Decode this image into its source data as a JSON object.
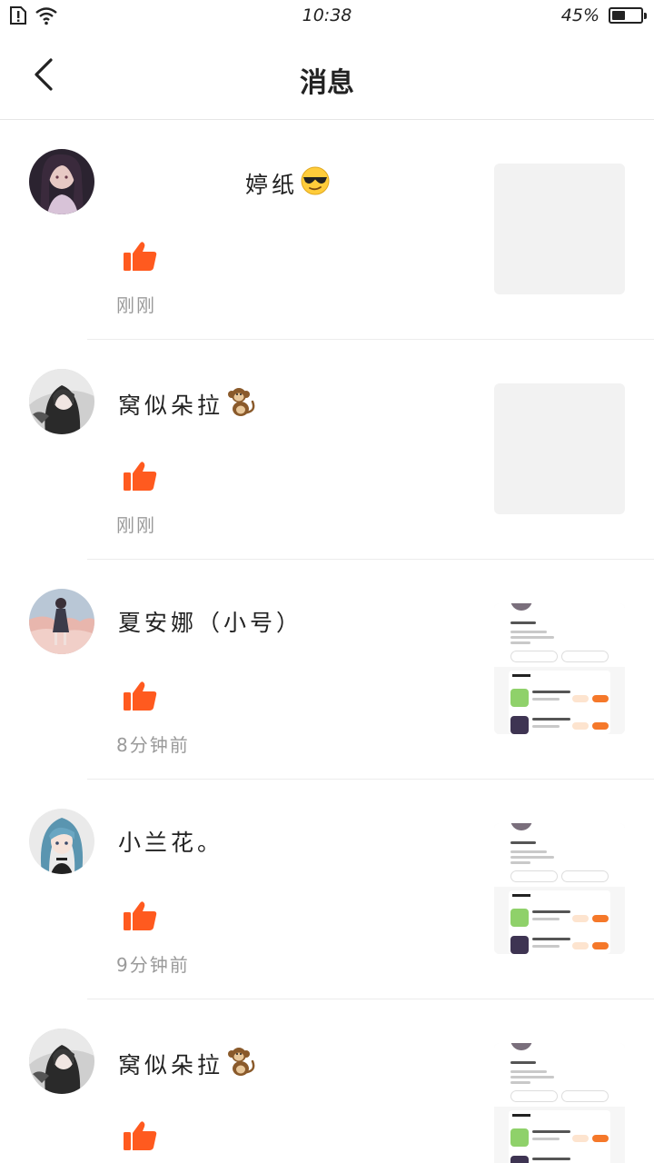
{
  "status_bar": {
    "time": "10:38",
    "battery_percent": "45%",
    "battery_level": 0.45,
    "icons": [
      "sim-alert-icon",
      "wifi-icon",
      "battery-icon"
    ]
  },
  "nav": {
    "back_icon": "back-chevron-icon",
    "title": "消息"
  },
  "messages": [
    {
      "name": "婷纸",
      "emoji": "sunglasses-emoji",
      "action_icon": "thumbs-up-icon",
      "time": "刚刚",
      "thumbnail": "blank"
    },
    {
      "name": "窝似朵拉",
      "emoji": "monkey-emoji",
      "action_icon": "thumbs-up-icon",
      "time": "刚刚",
      "thumbnail": "blank"
    },
    {
      "name": "夏安娜（小号）",
      "emoji": "",
      "action_icon": "thumbs-up-icon",
      "time": "8分钟前",
      "thumbnail": "profile-screenshot"
    },
    {
      "name": "小兰花。",
      "emoji": "",
      "action_icon": "thumbs-up-icon",
      "time": "9分钟前",
      "thumbnail": "profile-screenshot"
    },
    {
      "name": "窝似朵拉",
      "emoji": "monkey-emoji",
      "action_icon": "thumbs-up-icon",
      "time": "",
      "thumbnail": "profile-screenshot"
    }
  ],
  "colors": {
    "like_orange": "#ff5a1f",
    "divider": "#ececec",
    "time_gray": "#9a9a9a",
    "thumb_placeholder": "#f2f2f2"
  }
}
